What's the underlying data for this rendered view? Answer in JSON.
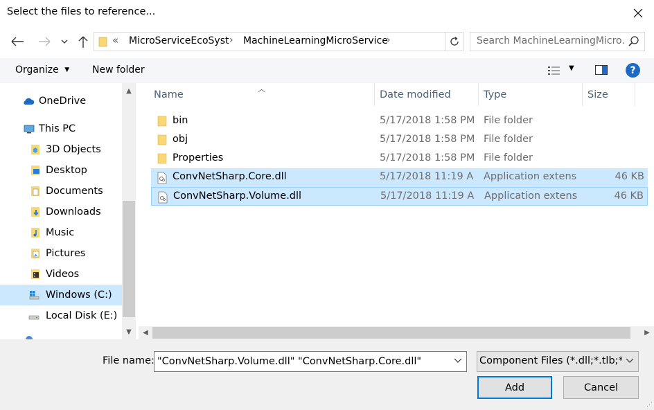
{
  "window": {
    "title": "Select the files to reference..."
  },
  "address": {
    "crumbs": [
      "MicroServiceEcoSyst",
      "MachineLearningMicroService"
    ],
    "overflow": "«"
  },
  "search": {
    "placeholder": "Search MachineLearningMicro..."
  },
  "toolbar": {
    "organize_label": "Organize",
    "new_folder_label": "New folder",
    "help_label": "?"
  },
  "nav": {
    "items": [
      {
        "label": "OneDrive",
        "icon": "cloud-icon"
      },
      {
        "label": "This PC",
        "icon": "computer-icon"
      },
      {
        "label": "3D Objects",
        "icon": "3d-objects-folder-icon"
      },
      {
        "label": "Desktop",
        "icon": "desktop-folder-icon"
      },
      {
        "label": "Documents",
        "icon": "documents-folder-icon"
      },
      {
        "label": "Downloads",
        "icon": "downloads-folder-icon"
      },
      {
        "label": "Music",
        "icon": "music-folder-icon"
      },
      {
        "label": "Pictures",
        "icon": "pictures-folder-icon"
      },
      {
        "label": "Videos",
        "icon": "videos-folder-icon"
      },
      {
        "label": "Windows (C:)",
        "icon": "windows-drive-icon",
        "selected": true
      },
      {
        "label": "Local Disk (E:)",
        "icon": "disk-drive-icon"
      }
    ]
  },
  "columns": {
    "name": "Name",
    "date": "Date modified",
    "type": "Type",
    "size": "Size"
  },
  "files": [
    {
      "name": "bin",
      "date": "5/17/2018 1:58 PM",
      "type": "File folder",
      "size": "",
      "kind": "folder",
      "selected": false
    },
    {
      "name": "obj",
      "date": "5/17/2018 1:58 PM",
      "type": "File folder",
      "size": "",
      "kind": "folder",
      "selected": false
    },
    {
      "name": "Properties",
      "date": "5/17/2018 1:58 PM",
      "type": "File folder",
      "size": "",
      "kind": "folder",
      "selected": false
    },
    {
      "name": "ConvNetSharp.Core.dll",
      "date": "5/17/2018 11:19 A",
      "type": "Application extens",
      "size": "46 KB",
      "kind": "dll",
      "selected": true
    },
    {
      "name": "ConvNetSharp.Volume.dll",
      "date": "5/17/2018 11:19 A",
      "type": "Application extens",
      "size": "46 KB",
      "kind": "dll",
      "selected": true
    }
  ],
  "bottom": {
    "file_name_label": "File name:",
    "file_name_value": "\"ConvNetSharp.Volume.dll\" \"ConvNetSharp.Core.dll\"",
    "filter_value": "Component Files (*.dll;*.tlb;*.olb",
    "add_label": "Add",
    "cancel_label": "Cancel"
  },
  "colors": {
    "selection": "#cce8ff",
    "selection_border": "#99d1ff",
    "accent": "#0078d7",
    "folder": "#f8d775"
  }
}
